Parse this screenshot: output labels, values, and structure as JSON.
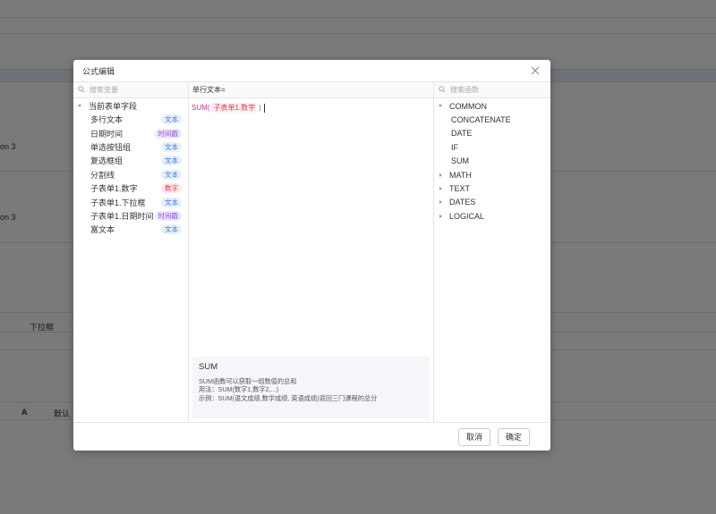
{
  "background": {
    "row1_label": "on 3",
    "row2_label": "on 3",
    "col_header": "下拉框",
    "toolbar_letter": "A",
    "toolbar_hint": "默认"
  },
  "modal": {
    "title": "公式编辑",
    "variables": {
      "search_placeholder": "搜索变量",
      "root_label": "当前表单字段",
      "fields": [
        {
          "name": "多行文本",
          "type": "文本",
          "kind": "text"
        },
        {
          "name": "日期时间",
          "type": "时间戳",
          "kind": "time"
        },
        {
          "name": "单选按钮组",
          "type": "文本",
          "kind": "text"
        },
        {
          "name": "复选框组",
          "type": "文本",
          "kind": "text"
        },
        {
          "name": "分割线",
          "type": "文本",
          "kind": "text"
        },
        {
          "name": "子表单1.数字",
          "type": "数字",
          "kind": "num"
        },
        {
          "name": "子表单1.下拉框",
          "type": "文本",
          "kind": "text"
        },
        {
          "name": "子表单1.日期时间",
          "type": "时间戳",
          "kind": "time"
        },
        {
          "name": "富文本",
          "type": "文本",
          "kind": "text"
        }
      ]
    },
    "editor": {
      "target_label": "单行文本=",
      "formula_func": "SUM(",
      "formula_token": "子表单1.数字",
      "formula_close": ")",
      "help": {
        "title": "SUM",
        "desc": "SUM函数可以获取一组数值的总和",
        "usage": "用法：SUM(数字1,数字2,...)",
        "example": "示例：SUM(语文成绩,数学成绩, 英语成绩)返回三门课程的总分"
      }
    },
    "functions": {
      "search_placeholder": "搜索函数",
      "common_label": "COMMON",
      "common_items": [
        "CONCATENATE",
        "DATE",
        "IF",
        "SUM"
      ],
      "groups": [
        "MATH",
        "TEXT",
        "DATES",
        "LOGICAL"
      ]
    },
    "footer": {
      "cancel_label": "取消",
      "ok_label": "确定"
    }
  },
  "colors": {
    "overlay": "#7b7b7b",
    "tag_text": "#3a7bd5",
    "tag_time": "#8a4fd8",
    "tag_num": "#e13a4f",
    "formula_func": "#c62aa0"
  }
}
